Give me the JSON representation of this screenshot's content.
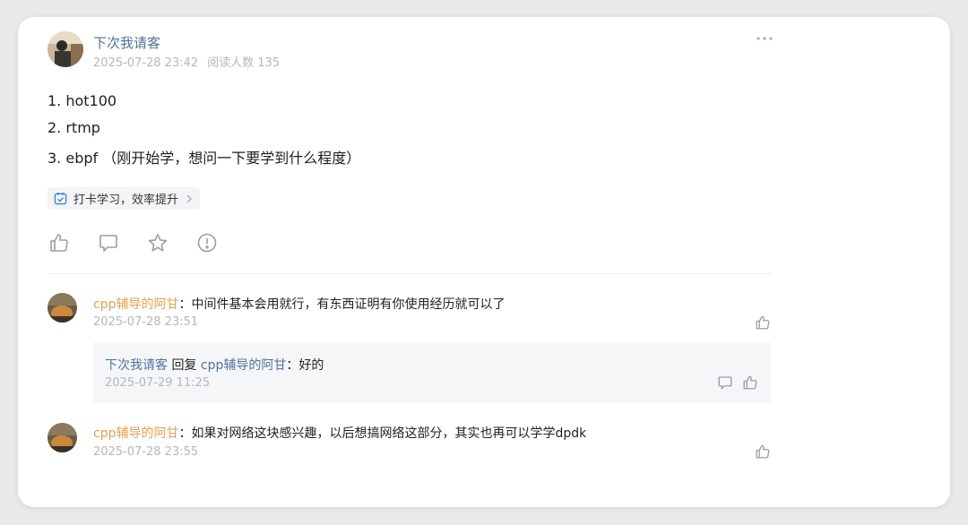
{
  "post": {
    "author": "下次我请客",
    "date": "2025-07-28 23:42",
    "reads": "阅读人数 135",
    "lines": [
      "1. hot100",
      "2. rtmp",
      "3. ebpf （刚开始学，想问一下要学到什么程度）"
    ],
    "tag": "打卡学习，效率提升",
    "actions": [
      "like-icon",
      "comment-icon",
      "star-icon",
      "report-icon"
    ]
  },
  "comments": [
    {
      "author": "cpp辅导的阿甘",
      "sep": "：",
      "text": "中间件基本会用就行，有东西证明有你使用经历就可以了",
      "time": "2025-07-28 23:51"
    },
    {
      "author": "cpp辅导的阿甘",
      "sep": "：",
      "text": "如果对网络这块感兴趣，以后想搞网络这部分，其实也再可以学学dpdk",
      "time": "2025-07-28 23:55"
    }
  ],
  "reply": {
    "author": "下次我请客",
    "verb": " 回复 ",
    "target": "cpp辅导的阿甘",
    "sep": "：",
    "text": "好的",
    "time": "2025-07-29 11:25"
  },
  "colors": {
    "name_blue": "#51729a",
    "name_orange": "#e2a04e",
    "muted": "#b4b7bd",
    "icon": "#9a9ea5",
    "tag_check": "#3c86d8"
  }
}
